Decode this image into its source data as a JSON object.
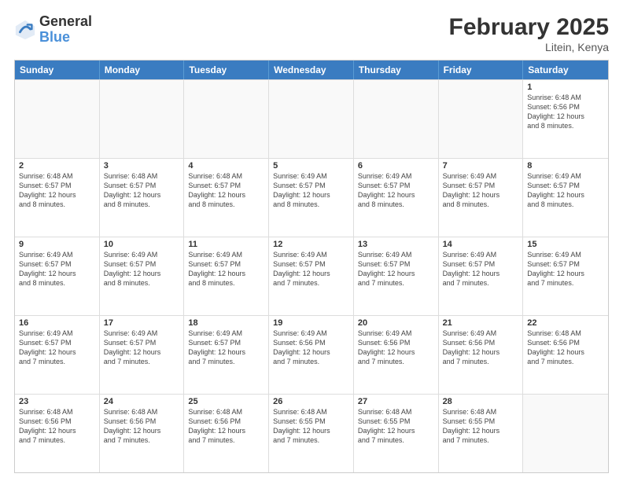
{
  "logo": {
    "line1": "General",
    "line2": "Blue"
  },
  "title": {
    "month_year": "February 2025",
    "location": "Litein, Kenya"
  },
  "header_days": [
    "Sunday",
    "Monday",
    "Tuesday",
    "Wednesday",
    "Thursday",
    "Friday",
    "Saturday"
  ],
  "rows": [
    [
      {
        "day": "",
        "text": "",
        "empty": true
      },
      {
        "day": "",
        "text": "",
        "empty": true
      },
      {
        "day": "",
        "text": "",
        "empty": true
      },
      {
        "day": "",
        "text": "",
        "empty": true
      },
      {
        "day": "",
        "text": "",
        "empty": true
      },
      {
        "day": "",
        "text": "",
        "empty": true
      },
      {
        "day": "1",
        "text": "Sunrise: 6:48 AM\nSunset: 6:56 PM\nDaylight: 12 hours\nand 8 minutes.",
        "empty": false
      }
    ],
    [
      {
        "day": "2",
        "text": "Sunrise: 6:48 AM\nSunset: 6:57 PM\nDaylight: 12 hours\nand 8 minutes.",
        "empty": false
      },
      {
        "day": "3",
        "text": "Sunrise: 6:48 AM\nSunset: 6:57 PM\nDaylight: 12 hours\nand 8 minutes.",
        "empty": false
      },
      {
        "day": "4",
        "text": "Sunrise: 6:48 AM\nSunset: 6:57 PM\nDaylight: 12 hours\nand 8 minutes.",
        "empty": false
      },
      {
        "day": "5",
        "text": "Sunrise: 6:49 AM\nSunset: 6:57 PM\nDaylight: 12 hours\nand 8 minutes.",
        "empty": false
      },
      {
        "day": "6",
        "text": "Sunrise: 6:49 AM\nSunset: 6:57 PM\nDaylight: 12 hours\nand 8 minutes.",
        "empty": false
      },
      {
        "day": "7",
        "text": "Sunrise: 6:49 AM\nSunset: 6:57 PM\nDaylight: 12 hours\nand 8 minutes.",
        "empty": false
      },
      {
        "day": "8",
        "text": "Sunrise: 6:49 AM\nSunset: 6:57 PM\nDaylight: 12 hours\nand 8 minutes.",
        "empty": false
      }
    ],
    [
      {
        "day": "9",
        "text": "Sunrise: 6:49 AM\nSunset: 6:57 PM\nDaylight: 12 hours\nand 8 minutes.",
        "empty": false
      },
      {
        "day": "10",
        "text": "Sunrise: 6:49 AM\nSunset: 6:57 PM\nDaylight: 12 hours\nand 8 minutes.",
        "empty": false
      },
      {
        "day": "11",
        "text": "Sunrise: 6:49 AM\nSunset: 6:57 PM\nDaylight: 12 hours\nand 8 minutes.",
        "empty": false
      },
      {
        "day": "12",
        "text": "Sunrise: 6:49 AM\nSunset: 6:57 PM\nDaylight: 12 hours\nand 7 minutes.",
        "empty": false
      },
      {
        "day": "13",
        "text": "Sunrise: 6:49 AM\nSunset: 6:57 PM\nDaylight: 12 hours\nand 7 minutes.",
        "empty": false
      },
      {
        "day": "14",
        "text": "Sunrise: 6:49 AM\nSunset: 6:57 PM\nDaylight: 12 hours\nand 7 minutes.",
        "empty": false
      },
      {
        "day": "15",
        "text": "Sunrise: 6:49 AM\nSunset: 6:57 PM\nDaylight: 12 hours\nand 7 minutes.",
        "empty": false
      }
    ],
    [
      {
        "day": "16",
        "text": "Sunrise: 6:49 AM\nSunset: 6:57 PM\nDaylight: 12 hours\nand 7 minutes.",
        "empty": false
      },
      {
        "day": "17",
        "text": "Sunrise: 6:49 AM\nSunset: 6:57 PM\nDaylight: 12 hours\nand 7 minutes.",
        "empty": false
      },
      {
        "day": "18",
        "text": "Sunrise: 6:49 AM\nSunset: 6:57 PM\nDaylight: 12 hours\nand 7 minutes.",
        "empty": false
      },
      {
        "day": "19",
        "text": "Sunrise: 6:49 AM\nSunset: 6:56 PM\nDaylight: 12 hours\nand 7 minutes.",
        "empty": false
      },
      {
        "day": "20",
        "text": "Sunrise: 6:49 AM\nSunset: 6:56 PM\nDaylight: 12 hours\nand 7 minutes.",
        "empty": false
      },
      {
        "day": "21",
        "text": "Sunrise: 6:49 AM\nSunset: 6:56 PM\nDaylight: 12 hours\nand 7 minutes.",
        "empty": false
      },
      {
        "day": "22",
        "text": "Sunrise: 6:48 AM\nSunset: 6:56 PM\nDaylight: 12 hours\nand 7 minutes.",
        "empty": false
      }
    ],
    [
      {
        "day": "23",
        "text": "Sunrise: 6:48 AM\nSunset: 6:56 PM\nDaylight: 12 hours\nand 7 minutes.",
        "empty": false
      },
      {
        "day": "24",
        "text": "Sunrise: 6:48 AM\nSunset: 6:56 PM\nDaylight: 12 hours\nand 7 minutes.",
        "empty": false
      },
      {
        "day": "25",
        "text": "Sunrise: 6:48 AM\nSunset: 6:56 PM\nDaylight: 12 hours\nand 7 minutes.",
        "empty": false
      },
      {
        "day": "26",
        "text": "Sunrise: 6:48 AM\nSunset: 6:55 PM\nDaylight: 12 hours\nand 7 minutes.",
        "empty": false
      },
      {
        "day": "27",
        "text": "Sunrise: 6:48 AM\nSunset: 6:55 PM\nDaylight: 12 hours\nand 7 minutes.",
        "empty": false
      },
      {
        "day": "28",
        "text": "Sunrise: 6:48 AM\nSunset: 6:55 PM\nDaylight: 12 hours\nand 7 minutes.",
        "empty": false
      },
      {
        "day": "",
        "text": "",
        "empty": true
      }
    ]
  ]
}
